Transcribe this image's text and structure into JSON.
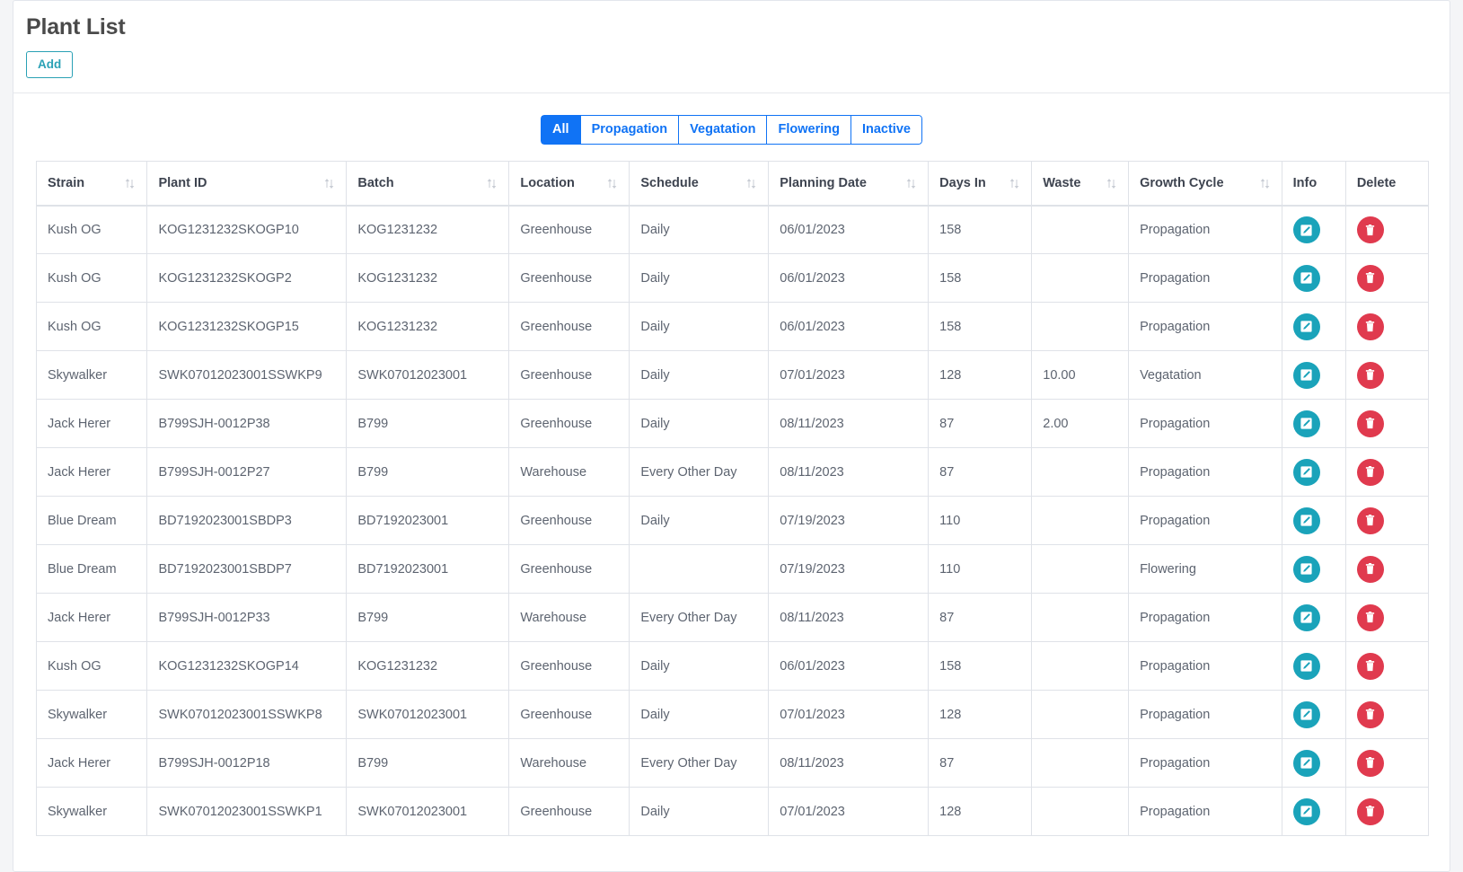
{
  "header": {
    "title": "Plant List",
    "add_label": "Add"
  },
  "filters": {
    "tabs": [
      {
        "label": "All",
        "active": true
      },
      {
        "label": "Propagation",
        "active": false
      },
      {
        "label": "Vegatation",
        "active": false
      },
      {
        "label": "Flowering",
        "active": false
      },
      {
        "label": "Inactive",
        "active": false
      }
    ]
  },
  "table": {
    "columns": [
      {
        "label": "Strain",
        "sortable": true
      },
      {
        "label": "Plant ID",
        "sortable": true
      },
      {
        "label": "Batch",
        "sortable": true
      },
      {
        "label": "Location",
        "sortable": true
      },
      {
        "label": "Schedule",
        "sortable": true
      },
      {
        "label": "Planning Date",
        "sortable": true
      },
      {
        "label": "Days In",
        "sortable": true
      },
      {
        "label": "Waste",
        "sortable": true
      },
      {
        "label": "Growth Cycle",
        "sortable": true
      },
      {
        "label": "Info",
        "sortable": false
      },
      {
        "label": "Delete",
        "sortable": false
      }
    ],
    "rows": [
      {
        "strain": "Kush OG",
        "plant_id": "KOG1231232SKOGP10",
        "batch": "KOG1231232",
        "location": "Greenhouse",
        "schedule": "Daily",
        "planning_date": "06/01/2023",
        "days_in": "158",
        "waste": "",
        "growth_cycle": "Propagation"
      },
      {
        "strain": "Kush OG",
        "plant_id": "KOG1231232SKOGP2",
        "batch": "KOG1231232",
        "location": "Greenhouse",
        "schedule": "Daily",
        "planning_date": "06/01/2023",
        "days_in": "158",
        "waste": "",
        "growth_cycle": "Propagation"
      },
      {
        "strain": "Kush OG",
        "plant_id": "KOG1231232SKOGP15",
        "batch": "KOG1231232",
        "location": "Greenhouse",
        "schedule": "Daily",
        "planning_date": "06/01/2023",
        "days_in": "158",
        "waste": "",
        "growth_cycle": "Propagation"
      },
      {
        "strain": "Skywalker",
        "plant_id": "SWK07012023001SSWKP9",
        "batch": "SWK07012023001",
        "location": "Greenhouse",
        "schedule": "Daily",
        "planning_date": "07/01/2023",
        "days_in": "128",
        "waste": "10.00",
        "growth_cycle": "Vegatation"
      },
      {
        "strain": "Jack Herer",
        "plant_id": "B799SJH-0012P38",
        "batch": "B799",
        "location": "Greenhouse",
        "schedule": "Daily",
        "planning_date": "08/11/2023",
        "days_in": "87",
        "waste": "2.00",
        "growth_cycle": "Propagation"
      },
      {
        "strain": "Jack Herer",
        "plant_id": "B799SJH-0012P27",
        "batch": "B799",
        "location": "Warehouse",
        "schedule": "Every Other Day",
        "planning_date": "08/11/2023",
        "days_in": "87",
        "waste": "",
        "growth_cycle": "Propagation"
      },
      {
        "strain": "Blue Dream",
        "plant_id": "BD7192023001SBDP3",
        "batch": "BD7192023001",
        "location": "Greenhouse",
        "schedule": "Daily",
        "planning_date": "07/19/2023",
        "days_in": "110",
        "waste": "",
        "growth_cycle": "Propagation"
      },
      {
        "strain": "Blue Dream",
        "plant_id": "BD7192023001SBDP7",
        "batch": "BD7192023001",
        "location": "Greenhouse",
        "schedule": "",
        "planning_date": "07/19/2023",
        "days_in": "110",
        "waste": "",
        "growth_cycle": "Flowering"
      },
      {
        "strain": "Jack Herer",
        "plant_id": "B799SJH-0012P33",
        "batch": "B799",
        "location": "Warehouse",
        "schedule": "Every Other Day",
        "planning_date": "08/11/2023",
        "days_in": "87",
        "waste": "",
        "growth_cycle": "Propagation"
      },
      {
        "strain": "Kush OG",
        "plant_id": "KOG1231232SKOGP14",
        "batch": "KOG1231232",
        "location": "Greenhouse",
        "schedule": "Daily",
        "planning_date": "06/01/2023",
        "days_in": "158",
        "waste": "",
        "growth_cycle": "Propagation"
      },
      {
        "strain": "Skywalker",
        "plant_id": "SWK07012023001SSWKP8",
        "batch": "SWK07012023001",
        "location": "Greenhouse",
        "schedule": "Daily",
        "planning_date": "07/01/2023",
        "days_in": "128",
        "waste": "",
        "growth_cycle": "Propagation"
      },
      {
        "strain": "Jack Herer",
        "plant_id": "B799SJH-0012P18",
        "batch": "B799",
        "location": "Warehouse",
        "schedule": "Every Other Day",
        "planning_date": "08/11/2023",
        "days_in": "87",
        "waste": "",
        "growth_cycle": "Propagation"
      },
      {
        "strain": "Skywalker",
        "plant_id": "SWK07012023001SSWKP1",
        "batch": "SWK07012023001",
        "location": "Greenhouse",
        "schedule": "Daily",
        "planning_date": "07/01/2023",
        "days_in": "128",
        "waste": "",
        "growth_cycle": "Propagation"
      }
    ],
    "row_actions": {
      "info_icon": "edit-square-icon",
      "delete_icon": "trash-icon"
    }
  },
  "colors": {
    "accent_teal": "#2aa1b5",
    "tab_blue": "#1073f5",
    "info_icon_bg": "#1aa3ba",
    "delete_icon_bg": "#e03a4e",
    "page_bg": "#f4f5f7",
    "border": "#dfe2e8"
  }
}
